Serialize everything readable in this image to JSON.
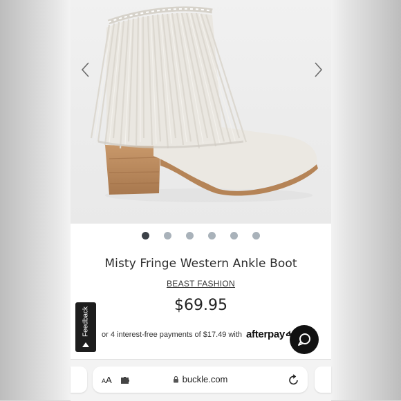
{
  "product": {
    "title": "Misty Fringe Western Ankle Boot",
    "brand": "BEAST FASHION",
    "price": "$69.95",
    "installments_text": "or 4 interest-free payments of $17.49 with",
    "afterpay_label": "afterpay"
  },
  "carousel": {
    "slide_count": 6,
    "active_index": 0,
    "prev_icon": "chevron-left-icon",
    "next_icon": "chevron-right-icon"
  },
  "feedback": {
    "label": "Feedback"
  },
  "chat": {
    "icon": "chat-bubble-icon"
  },
  "browser": {
    "text_size_label": "AA",
    "url": "buckle.com",
    "lock_icon": "lock-icon",
    "reload_icon": "reload-icon",
    "extension_icon": "puzzle-icon"
  },
  "colors": {
    "accent_dark": "#111111",
    "dot_inactive": "#a9b2ba",
    "dot_active": "#3c4148"
  }
}
